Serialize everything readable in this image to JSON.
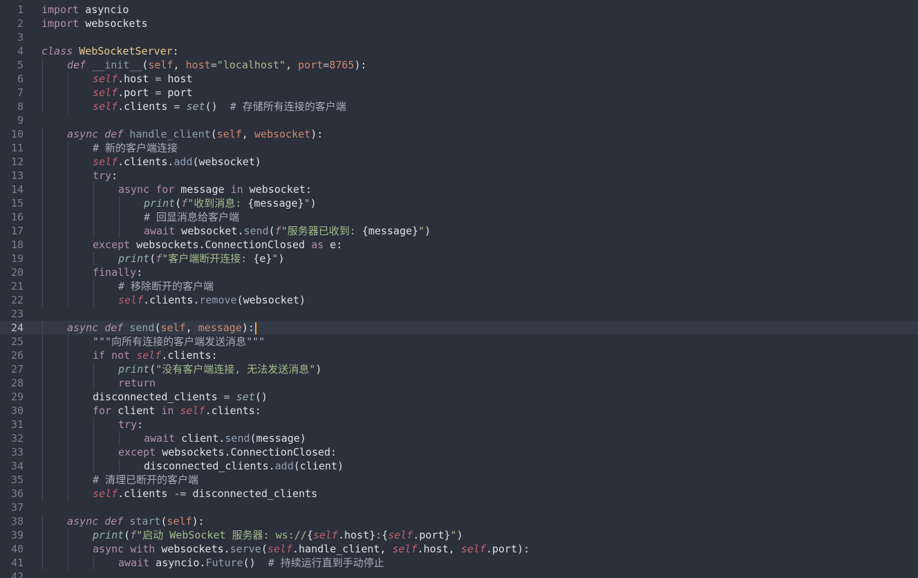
{
  "editor": {
    "current_line": 24,
    "theme_colors": {
      "background": "#2b303b",
      "current_line": "#333a46",
      "caret": "#f0a030",
      "line_number": "#78818f"
    },
    "lines": [
      {
        "n": "1",
        "indent": 0,
        "tokens": [
          [
            "kw",
            "import"
          ],
          [
            "t",
            " asyncio"
          ]
        ]
      },
      {
        "n": "2",
        "indent": 0,
        "tokens": [
          [
            "kw",
            "import"
          ],
          [
            "t",
            " websockets"
          ]
        ]
      },
      {
        "n": "3",
        "indent": 0,
        "tokens": []
      },
      {
        "n": "4",
        "indent": 0,
        "tokens": [
          [
            "kwi",
            "class"
          ],
          [
            "t",
            " "
          ],
          [
            "cls",
            "WebSocketServer"
          ],
          [
            "t",
            ":"
          ]
        ]
      },
      {
        "n": "5",
        "indent": 1,
        "tokens": [
          [
            "kwi",
            "def"
          ],
          [
            "t",
            " "
          ],
          [
            "fn",
            "__init__"
          ],
          [
            "t",
            "("
          ],
          [
            "prm",
            "self"
          ],
          [
            "t",
            ", "
          ],
          [
            "prm",
            "host"
          ],
          [
            "op",
            "="
          ],
          [
            "str",
            "\"localhost\""
          ],
          [
            "t",
            ", "
          ],
          [
            "prm",
            "port"
          ],
          [
            "op",
            "="
          ],
          [
            "num",
            "8765"
          ],
          [
            "t",
            "):"
          ]
        ]
      },
      {
        "n": "6",
        "indent": 2,
        "tokens": [
          [
            "slf",
            "self"
          ],
          [
            "t",
            ".host "
          ],
          [
            "op",
            "="
          ],
          [
            "t",
            " host"
          ]
        ]
      },
      {
        "n": "7",
        "indent": 2,
        "tokens": [
          [
            "slf",
            "self"
          ],
          [
            "t",
            ".port "
          ],
          [
            "op",
            "="
          ],
          [
            "t",
            " port"
          ]
        ]
      },
      {
        "n": "8",
        "indent": 2,
        "tokens": [
          [
            "slf",
            "self"
          ],
          [
            "t",
            ".clients "
          ],
          [
            "op",
            "="
          ],
          [
            "t",
            " "
          ],
          [
            "bi",
            "set"
          ],
          [
            "t",
            "()  "
          ],
          [
            "cmt",
            "# 存储所有连接的客户端"
          ]
        ]
      },
      {
        "n": "9",
        "indent": 0,
        "tokens": []
      },
      {
        "n": "10",
        "indent": 1,
        "tokens": [
          [
            "kwi",
            "async"
          ],
          [
            "t",
            " "
          ],
          [
            "kwi",
            "def"
          ],
          [
            "t",
            " "
          ],
          [
            "fn",
            "handle_client"
          ],
          [
            "t",
            "("
          ],
          [
            "prm",
            "self"
          ],
          [
            "t",
            ", "
          ],
          [
            "prm",
            "websocket"
          ],
          [
            "t",
            "):"
          ]
        ]
      },
      {
        "n": "11",
        "indent": 2,
        "tokens": [
          [
            "cmt",
            "# 新的客户端连接"
          ]
        ]
      },
      {
        "n": "12",
        "indent": 2,
        "tokens": [
          [
            "slf",
            "self"
          ],
          [
            "t",
            ".clients."
          ],
          [
            "mth",
            "add"
          ],
          [
            "t",
            "(websocket)"
          ]
        ]
      },
      {
        "n": "13",
        "indent": 2,
        "tokens": [
          [
            "kw",
            "try"
          ],
          [
            "t",
            ":"
          ]
        ]
      },
      {
        "n": "14",
        "indent": 3,
        "tokens": [
          [
            "kw",
            "async"
          ],
          [
            "t",
            " "
          ],
          [
            "kw",
            "for"
          ],
          [
            "t",
            " message "
          ],
          [
            "kw",
            "in"
          ],
          [
            "t",
            " websocket:"
          ]
        ]
      },
      {
        "n": "15",
        "indent": 4,
        "tokens": [
          [
            "bi",
            "print"
          ],
          [
            "t",
            "("
          ],
          [
            "fstr",
            "f"
          ],
          [
            "str",
            "\"收到消息: "
          ],
          [
            "t",
            "{message}"
          ],
          [
            "str",
            "\""
          ],
          [
            "t",
            ")"
          ]
        ]
      },
      {
        "n": "16",
        "indent": 4,
        "tokens": [
          [
            "cmt",
            "# 回显消息给客户端"
          ]
        ]
      },
      {
        "n": "17",
        "indent": 4,
        "tokens": [
          [
            "kw",
            "await"
          ],
          [
            "t",
            " websocket."
          ],
          [
            "mth",
            "send"
          ],
          [
            "t",
            "("
          ],
          [
            "fstr",
            "f"
          ],
          [
            "str",
            "\"服务器已收到: "
          ],
          [
            "t",
            "{message}"
          ],
          [
            "str",
            "\""
          ],
          [
            "t",
            ")"
          ]
        ]
      },
      {
        "n": "18",
        "indent": 2,
        "tokens": [
          [
            "kw",
            "except"
          ],
          [
            "t",
            " websockets.ConnectionClosed "
          ],
          [
            "kw",
            "as"
          ],
          [
            "t",
            " e:"
          ]
        ]
      },
      {
        "n": "19",
        "indent": 3,
        "tokens": [
          [
            "bi",
            "print"
          ],
          [
            "t",
            "("
          ],
          [
            "fstr",
            "f"
          ],
          [
            "str",
            "\"客户端断开连接: "
          ],
          [
            "t",
            "{e}"
          ],
          [
            "str",
            "\""
          ],
          [
            "t",
            ")"
          ]
        ]
      },
      {
        "n": "20",
        "indent": 2,
        "tokens": [
          [
            "kw",
            "finally"
          ],
          [
            "t",
            ":"
          ]
        ]
      },
      {
        "n": "21",
        "indent": 3,
        "tokens": [
          [
            "cmt",
            "# 移除断开的客户端"
          ]
        ]
      },
      {
        "n": "22",
        "indent": 3,
        "tokens": [
          [
            "slf",
            "self"
          ],
          [
            "t",
            ".clients."
          ],
          [
            "mth",
            "remove"
          ],
          [
            "t",
            "(websocket)"
          ]
        ]
      },
      {
        "n": "23",
        "indent": 0,
        "tokens": []
      },
      {
        "n": "24",
        "indent": 1,
        "caret": true,
        "tokens": [
          [
            "kwi",
            "async"
          ],
          [
            "t",
            " "
          ],
          [
            "kwi",
            "def"
          ],
          [
            "t",
            " "
          ],
          [
            "fn",
            "send"
          ],
          [
            "t",
            "("
          ],
          [
            "prm",
            "self"
          ],
          [
            "t",
            ", "
          ],
          [
            "prm",
            "message"
          ],
          [
            "t",
            "):"
          ]
        ]
      },
      {
        "n": "25",
        "indent": 2,
        "tokens": [
          [
            "cmt",
            "\"\"\"向所有连接的客户端发送消息\"\"\""
          ]
        ]
      },
      {
        "n": "26",
        "indent": 2,
        "tokens": [
          [
            "kw",
            "if"
          ],
          [
            "t",
            " "
          ],
          [
            "kw",
            "not"
          ],
          [
            "t",
            " "
          ],
          [
            "slf",
            "self"
          ],
          [
            "t",
            ".clients:"
          ]
        ]
      },
      {
        "n": "27",
        "indent": 3,
        "tokens": [
          [
            "bi",
            "print"
          ],
          [
            "t",
            "("
          ],
          [
            "str",
            "\"没有客户端连接, 无法发送消息\""
          ],
          [
            "t",
            ")"
          ]
        ]
      },
      {
        "n": "28",
        "indent": 3,
        "tokens": [
          [
            "kw",
            "return"
          ]
        ]
      },
      {
        "n": "29",
        "indent": 2,
        "tokens": [
          [
            "t",
            "disconnected_clients "
          ],
          [
            "op",
            "="
          ],
          [
            "t",
            " "
          ],
          [
            "bi",
            "set"
          ],
          [
            "t",
            "()"
          ]
        ]
      },
      {
        "n": "30",
        "indent": 2,
        "tokens": [
          [
            "kw",
            "for"
          ],
          [
            "t",
            " client "
          ],
          [
            "kw",
            "in"
          ],
          [
            "t",
            " "
          ],
          [
            "slf",
            "self"
          ],
          [
            "t",
            ".clients:"
          ]
        ]
      },
      {
        "n": "31",
        "indent": 3,
        "tokens": [
          [
            "kw",
            "try"
          ],
          [
            "t",
            ":"
          ]
        ]
      },
      {
        "n": "32",
        "indent": 4,
        "tokens": [
          [
            "kw",
            "await"
          ],
          [
            "t",
            " client."
          ],
          [
            "mth",
            "send"
          ],
          [
            "t",
            "(message)"
          ]
        ]
      },
      {
        "n": "33",
        "indent": 3,
        "tokens": [
          [
            "kw",
            "except"
          ],
          [
            "t",
            " websockets.ConnectionClosed:"
          ]
        ]
      },
      {
        "n": "34",
        "indent": 4,
        "tokens": [
          [
            "t",
            "disconnected_clients."
          ],
          [
            "mth",
            "add"
          ],
          [
            "t",
            "(client)"
          ]
        ]
      },
      {
        "n": "35",
        "indent": 2,
        "tokens": [
          [
            "cmt",
            "# 清理已断开的客户端"
          ]
        ]
      },
      {
        "n": "36",
        "indent": 2,
        "tokens": [
          [
            "slf",
            "self"
          ],
          [
            "t",
            ".clients "
          ],
          [
            "op",
            "-="
          ],
          [
            "t",
            " disconnected_clients"
          ]
        ]
      },
      {
        "n": "37",
        "indent": 0,
        "tokens": []
      },
      {
        "n": "38",
        "indent": 1,
        "tokens": [
          [
            "kwi",
            "async"
          ],
          [
            "t",
            " "
          ],
          [
            "kwi",
            "def"
          ],
          [
            "t",
            " "
          ],
          [
            "fn",
            "start"
          ],
          [
            "t",
            "("
          ],
          [
            "prm",
            "self"
          ],
          [
            "t",
            "):"
          ]
        ]
      },
      {
        "n": "39",
        "indent": 2,
        "tokens": [
          [
            "bi",
            "print"
          ],
          [
            "t",
            "("
          ],
          [
            "fstr",
            "f"
          ],
          [
            "str",
            "\"启动 WebSocket 服务器: ws://"
          ],
          [
            "t",
            "{"
          ],
          [
            "slf",
            "self"
          ],
          [
            "t",
            ".host}"
          ],
          [
            "str",
            ":"
          ],
          [
            "t",
            "{"
          ],
          [
            "slf",
            "self"
          ],
          [
            "t",
            ".port}"
          ],
          [
            "str",
            "\""
          ],
          [
            "t",
            ")"
          ]
        ]
      },
      {
        "n": "40",
        "indent": 2,
        "tokens": [
          [
            "kw",
            "async"
          ],
          [
            "t",
            " "
          ],
          [
            "kw",
            "with"
          ],
          [
            "t",
            " websockets."
          ],
          [
            "mth",
            "serve"
          ],
          [
            "t",
            "("
          ],
          [
            "slf",
            "self"
          ],
          [
            "t",
            ".handle_client, "
          ],
          [
            "slf",
            "self"
          ],
          [
            "t",
            ".host, "
          ],
          [
            "slf",
            "self"
          ],
          [
            "t",
            ".port):"
          ]
        ]
      },
      {
        "n": "41",
        "indent": 3,
        "tokens": [
          [
            "kw",
            "await"
          ],
          [
            "t",
            " asyncio."
          ],
          [
            "mth",
            "Future"
          ],
          [
            "t",
            "()  "
          ],
          [
            "cmt",
            "# 持续运行直到手动停止"
          ]
        ]
      },
      {
        "n": "42",
        "indent": 0,
        "tokens": []
      }
    ]
  }
}
